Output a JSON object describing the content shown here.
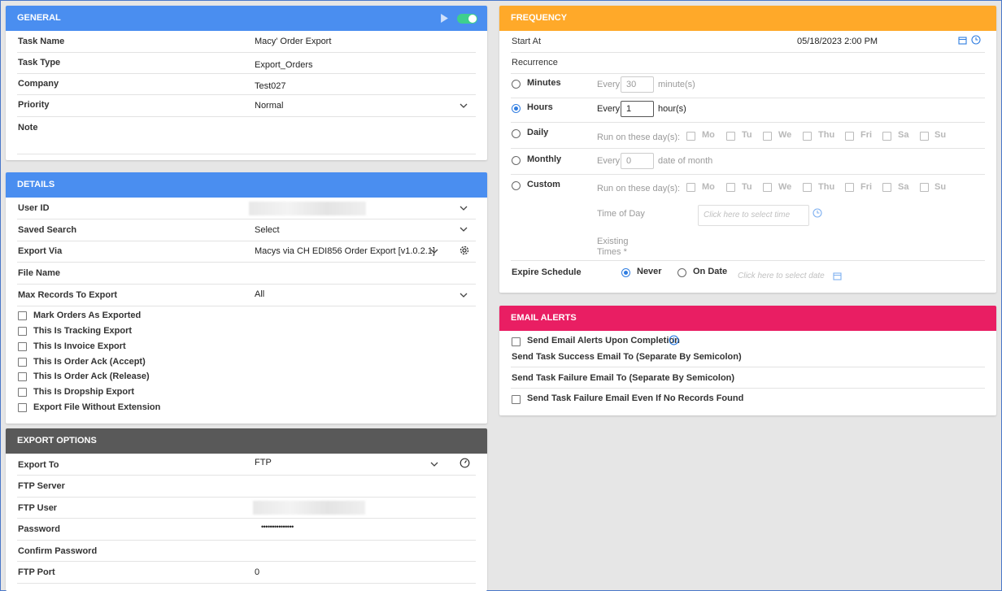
{
  "general": {
    "title": "GENERAL",
    "task_name_label": "Task Name",
    "task_name": "Macy' Order Export",
    "task_type_label": "Task Type",
    "task_type": "Export_Orders",
    "company_label": "Company",
    "company": "Test027",
    "priority_label": "Priority",
    "priority": "Normal",
    "note_label": "Note",
    "toggle_on": true
  },
  "details": {
    "title": "DETAILS",
    "user_id_label": "User ID",
    "saved_search_label": "Saved Search",
    "saved_search": "Select",
    "export_via_label": "Export Via",
    "export_via": "Macys via CH EDI856 Order Export [v1.0.2.1]",
    "file_name_label": "File Name",
    "max_records_label": "Max Records To Export",
    "max_records": "All",
    "checkboxes": [
      "Mark Orders As Exported",
      "This Is Tracking Export",
      "This Is Invoice Export",
      "This Is Order Ack (Accept)",
      "This Is Order Ack (Release)",
      "This Is Dropship Export",
      "Export File Without Extension"
    ]
  },
  "export_options": {
    "title": "EXPORT OPTIONS",
    "export_to_label": "Export To",
    "export_to": "FTP",
    "ftp_server_label": "FTP Server",
    "ftp_user_label": "FTP User",
    "password_label": "Password",
    "password_mask": "•••••••••••••••",
    "confirm_password_label": "Confirm Password",
    "ftp_port_label": "FTP Port",
    "ftp_port": "0"
  },
  "frequency": {
    "title": "FREQUENCY",
    "start_at_label": "Start At",
    "start_at": "05/18/2023 2:00 PM",
    "recurrence_label": "Recurrence",
    "minutes_label": "Minutes",
    "minutes_every": "Every",
    "minutes_value": "30",
    "minutes_unit": "minute(s)",
    "hours_label": "Hours",
    "hours_every": "Every",
    "hours_value": "1",
    "hours_unit": "hour(s)",
    "daily_label": "Daily",
    "run_on_days": "Run on these day(s):",
    "days": [
      "Mo",
      "Tu",
      "We",
      "Thu",
      "Fri",
      "Sa",
      "Su"
    ],
    "monthly_label": "Monthly",
    "monthly_every": "Every",
    "monthly_value": "0",
    "monthly_unit": "date of month",
    "custom_label": "Custom",
    "custom_run_on_days": "Run on these day(s):",
    "time_of_day_label": "Time of Day",
    "time_placeholder": "Click here to select time",
    "existing_times_label": "Existing Times *",
    "expire_label": "Expire Schedule",
    "never_label": "Never",
    "on_date_label": "On Date",
    "date_placeholder": "Click here to select date"
  },
  "email_alerts": {
    "title": "EMAIL ALERTS",
    "send_upon_completion": "Send Email Alerts Upon Completion",
    "success_label": "Send Task Success Email To (Separate By Semicolon)",
    "failure_label": "Send Task Failure Email To (Separate By Semicolon)",
    "failure_no_records": "Send Task Failure Email Even If No Records Found"
  },
  "colors": {
    "general_header": "#4a8ef0",
    "frequency_header": "#ffa929",
    "email_header": "#e91e63",
    "export_header": "#595959",
    "toggle": "#3ecf8e",
    "radio_accent": "#2f7de1"
  }
}
